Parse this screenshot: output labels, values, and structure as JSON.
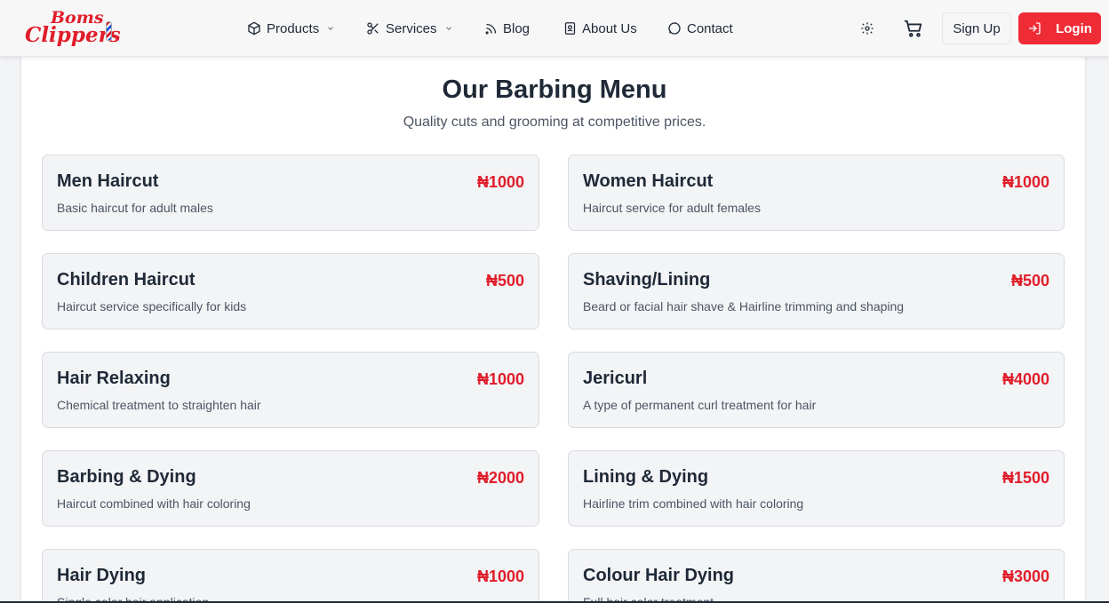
{
  "brand": {
    "logo_top": "Boms",
    "logo_bottom": "Clippers",
    "accent": "#e11d2a"
  },
  "nav": {
    "products": "Products",
    "services": "Services",
    "blog": "Blog",
    "about": "About Us",
    "contact": "Contact"
  },
  "actions": {
    "settings_icon": "gear-icon",
    "cart_icon": "cart-icon",
    "signup": "Sign Up",
    "login": "Login",
    "login_color": "#ef2b36"
  },
  "page": {
    "title": "Our Barbing Menu",
    "subtitle": "Quality cuts and grooming at competitive prices."
  },
  "services": [
    {
      "name": "Men Haircut",
      "price": "₦1000",
      "description": "Basic haircut for adult males"
    },
    {
      "name": "Women Haircut",
      "price": "₦1000",
      "description": "Haircut service for adult females"
    },
    {
      "name": "Children Haircut",
      "price": "₦500",
      "description": "Haircut service specifically for kids"
    },
    {
      "name": "Shaving/Lining",
      "price": "₦500",
      "description": "Beard or facial hair shave & Hairline trimming and shaping"
    },
    {
      "name": "Hair Relaxing",
      "price": "₦1000",
      "description": "Chemical treatment to straighten hair"
    },
    {
      "name": "Jericurl",
      "price": "₦4000",
      "description": "A type of permanent curl treatment for hair"
    },
    {
      "name": "Barbing & Dying",
      "price": "₦2000",
      "description": "Haircut combined with hair coloring"
    },
    {
      "name": "Lining & Dying",
      "price": "₦1500",
      "description": "Hairline trim combined with hair coloring"
    },
    {
      "name": "Hair Dying",
      "price": "₦1000",
      "description": "Single color hair application"
    },
    {
      "name": "Colour Hair Dying",
      "price": "₦3000",
      "description": "Full hair color treatment"
    }
  ]
}
